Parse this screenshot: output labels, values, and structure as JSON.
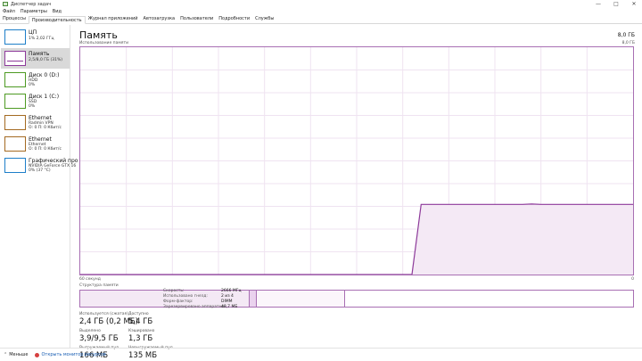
{
  "window": {
    "title": "Диспетчер задач",
    "minimize": "—",
    "maximize": "□",
    "close": "✕"
  },
  "menu": [
    "Файл",
    "Параметры",
    "Вид"
  ],
  "tabs": [
    {
      "label": "Процессы",
      "active": false
    },
    {
      "label": "Производительность",
      "active": true
    },
    {
      "label": "Журнал приложений",
      "active": false
    },
    {
      "label": "Автозагрузка",
      "active": false
    },
    {
      "label": "Пользователи",
      "active": false
    },
    {
      "label": "Подробности",
      "active": false
    },
    {
      "label": "Службы",
      "active": false
    }
  ],
  "sidebar": [
    {
      "name": "ЦП",
      "sub1": "1% 2,02 ГГц",
      "sub2": ""
    },
    {
      "name": "Память",
      "sub1": "2,5/8,0 ГБ (31%)",
      "sub2": ""
    },
    {
      "name": "Диск 0 (D:)",
      "sub1": "HDD",
      "sub2": "0%"
    },
    {
      "name": "Диск 1 (C:)",
      "sub1": "SSD",
      "sub2": "0%"
    },
    {
      "name": "Ethernet",
      "sub1": "Radmin VPN",
      "sub2": "О: 0 П: 0 Кбит/с"
    },
    {
      "name": "Ethernet",
      "sub1": "Ethernet",
      "sub2": "О: 0 П: 0 Кбит/с"
    },
    {
      "name": "Графический про",
      "sub1": "NVIDIA GeForce GTX 16",
      "sub2": "0% (37 °C)"
    }
  ],
  "main": {
    "title": "Память",
    "total": "8,0 ГБ",
    "graph_label": "Использование памяти",
    "graph_max": "8,0 ГБ",
    "axis_left": "60 секунд",
    "axis_right": "0",
    "composition_label": "Структура памяти"
  },
  "usage_graph": {
    "y_max_gb": 8.0,
    "samples_gb": [
      0,
      0,
      0,
      0,
      0,
      0,
      0,
      0,
      0,
      0,
      0,
      0,
      0,
      0,
      0,
      0,
      0,
      0,
      0,
      0,
      0,
      0,
      0,
      0,
      0,
      0,
      0,
      0,
      0,
      0,
      0,
      0,
      0,
      0,
      0,
      0,
      0,
      2.47,
      2.47,
      2.47,
      2.47,
      2.47,
      2.47,
      2.47,
      2.47,
      2.47,
      2.47,
      2.47,
      2.47,
      2.48,
      2.47,
      2.47,
      2.47,
      2.47,
      2.47,
      2.47,
      2.47,
      2.47,
      2.47,
      2.47,
      2.47
    ]
  },
  "stats": {
    "in_use_label": "Используется (сжатая)",
    "in_use": "2,4 ГБ (0,2 МБ)",
    "available_label": "Доступно",
    "available": "5,4 ГБ",
    "committed_label": "Выделено",
    "committed": "3,9/9,5 ГБ",
    "cached_label": "Кэшировано",
    "cached": "1,3 ГБ",
    "paged_label": "Выгружаемый пул",
    "paged": "166 МБ",
    "nonpaged_label": "Невыгружаемый пул",
    "nonpaged": "135 МБ"
  },
  "specs": [
    {
      "label": "Скорость:",
      "value": "2666 МГц"
    },
    {
      "label": "Использовано гнезд:",
      "value": "2 из 4"
    },
    {
      "label": "Форм-фактор:",
      "value": "DIMM"
    },
    {
      "label": "Зарезервировано аппаратно:",
      "value": "48,7 МБ"
    }
  ],
  "status": {
    "less": "Меньше",
    "monitor": "Открыть монитор ресурсов"
  },
  "colors": {
    "memory_accent": "#8d3a9a",
    "graph_fill": "#f4e9f5"
  }
}
